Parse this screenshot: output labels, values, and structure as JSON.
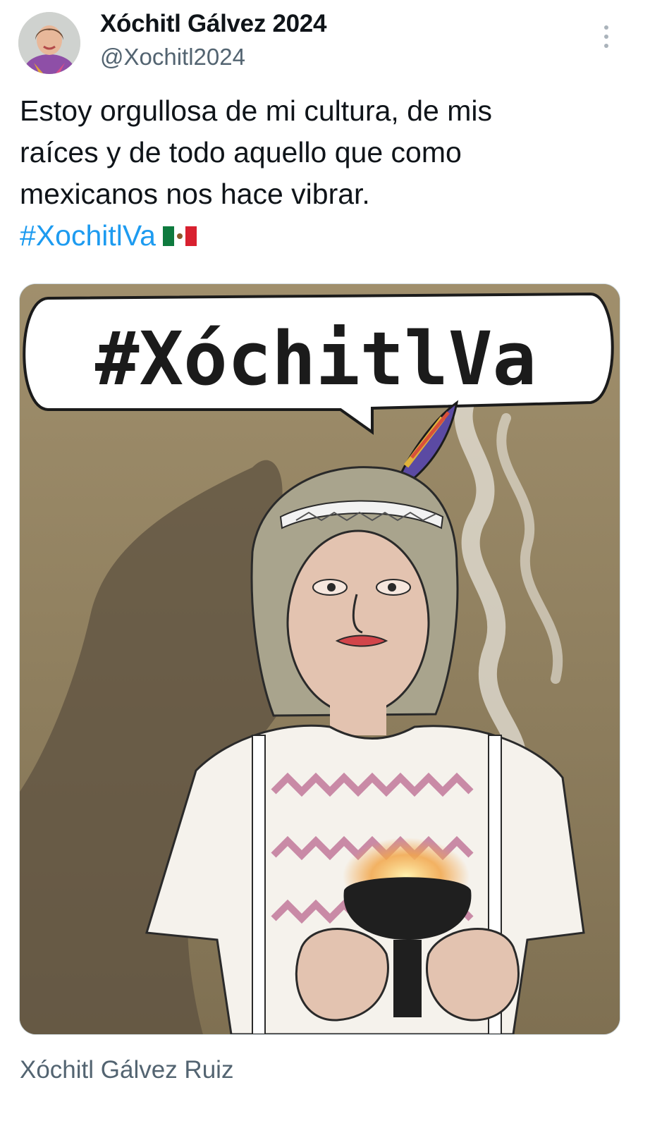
{
  "tweet": {
    "display_name": "Xóchitl Gálvez 2024",
    "handle": "@Xochitl2024",
    "text_lines": [
      "Estoy orgullosa de mi cultura, de mis",
      "raíces y de todo aquello que como",
      "mexicanos nos hace vibrar."
    ],
    "hashtag": "#XochitlVa",
    "flag_emoji": "mexico-flag",
    "more_icon": "more-vertical-icon"
  },
  "media": {
    "speech_text": "#XóchitlVa",
    "caption": "Xóchitl Gálvez Ruiz"
  },
  "colors": {
    "hashtag": "#1d9bf0",
    "muted_text": "#536471",
    "cartoon_background": "#8d7e60"
  }
}
